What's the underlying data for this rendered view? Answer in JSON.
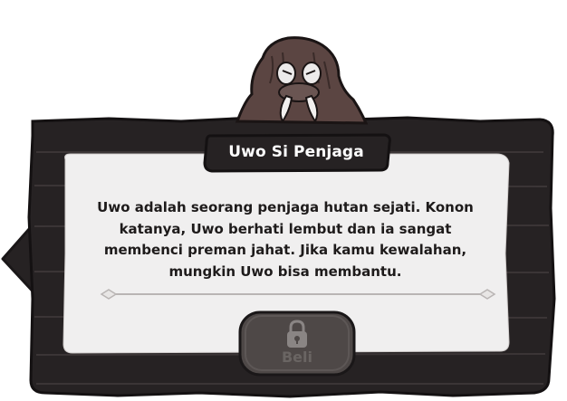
{
  "dialog": {
    "character_name": "Uwo Si Penjaga",
    "description": "Uwo adalah seorang penjaga hutan sejati. Konon katanya, Uwo berhati lembut dan ia sangat membenci preman jahat. Jika kamu kewalahan, mungkin Uwo bisa membantu.",
    "buy_label": "Beli",
    "buy_state": "locked"
  },
  "icons": {
    "portrait": "walrus-guardian-portrait",
    "lock": "lock-icon",
    "side_arrow": "left-arrow-tab-icon",
    "divider": "ornamental-divider"
  },
  "colors": {
    "frame": "#262223",
    "panel": "#f0efef",
    "text": "#1e1b1b",
    "button": "#4e4847",
    "button_text": "#6a6563"
  }
}
